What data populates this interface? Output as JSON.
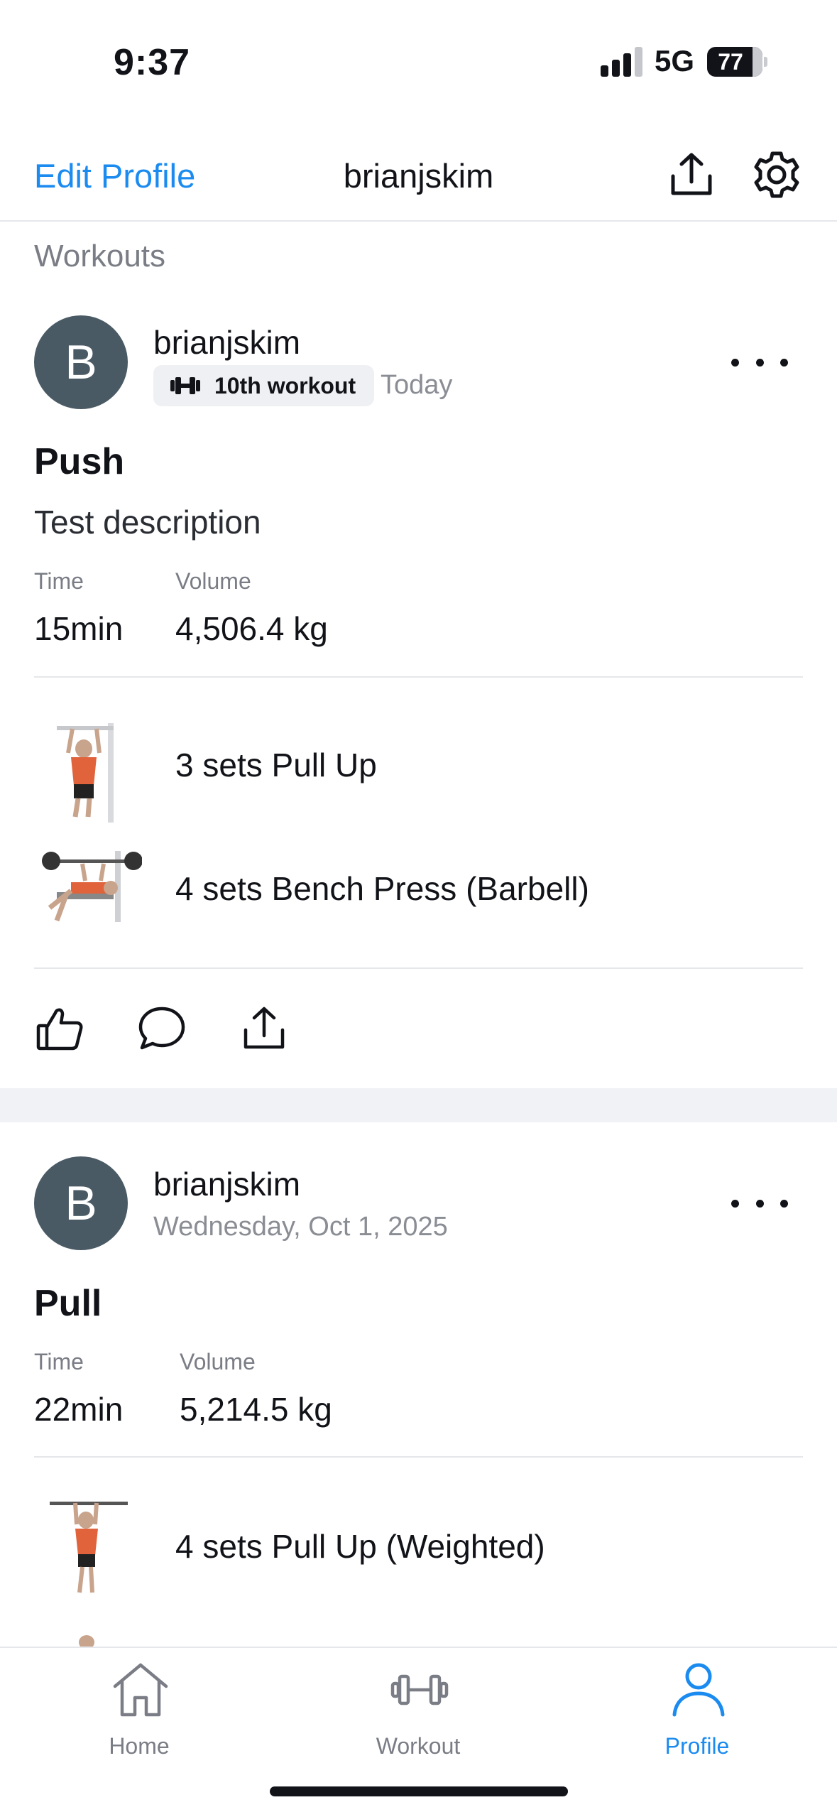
{
  "status_bar": {
    "time": "9:37",
    "network": "5G",
    "battery": "77"
  },
  "header": {
    "edit_label": "Edit Profile",
    "title": "brianjskim",
    "share_icon": "share-icon",
    "settings_icon": "gear-icon"
  },
  "section_label": "Workouts",
  "posts": [
    {
      "avatar_letter": "B",
      "username": "brianjskim",
      "badge": "10th workout",
      "date": "Today",
      "title": "Push",
      "description": "Test description",
      "time_label": "Time",
      "time_value": "15min",
      "volume_label": "Volume",
      "volume_value": "4,506.4 kg",
      "exercises": [
        {
          "text": "3 sets Pull Up"
        },
        {
          "text": "4 sets Bench Press (Barbell)"
        }
      ]
    },
    {
      "avatar_letter": "B",
      "username": "brianjskim",
      "date": "Wednesday, Oct 1, 2025",
      "title": "Pull",
      "time_label": "Time",
      "time_value": "22min",
      "volume_label": "Volume",
      "volume_value": "5,214.5 kg",
      "exercises": [
        {
          "text": "4 sets Pull Up (Weighted)"
        }
      ]
    }
  ],
  "tabs": [
    {
      "label": "Home",
      "icon": "home-icon"
    },
    {
      "label": "Workout",
      "icon": "dumbbell-icon"
    },
    {
      "label": "Profile",
      "icon": "profile-icon",
      "active": true
    }
  ],
  "colors": {
    "accent": "#1b8bf0",
    "avatar": "#4a5a65",
    "muscle": "#e0633c"
  }
}
